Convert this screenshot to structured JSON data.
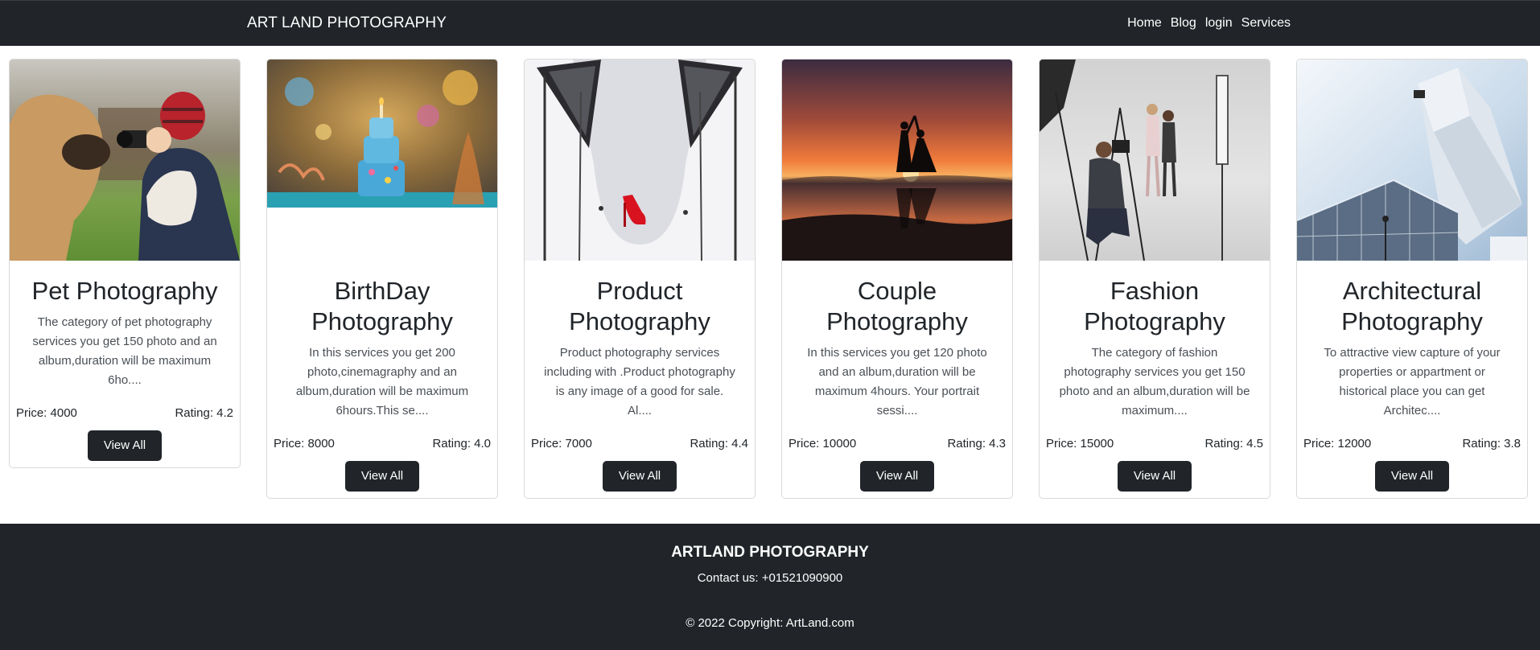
{
  "navbar": {
    "brand": "ART LAND PHOTOGRAPHY",
    "links": [
      "Home",
      "Blog",
      "login",
      "Services"
    ]
  },
  "cards": [
    {
      "image": "dog-and-child-photographer-photo",
      "title": "Pet Photography",
      "description": "The category of pet photography services you get 150 photo and an album,duration will be maximum 6ho....",
      "price": "Price: 4000",
      "rating": "Rating: 4.2",
      "button": "View All"
    },
    {
      "image": "birthday-cake-photo",
      "title": "BirthDay Photography",
      "description": "In this services you get 200 photo,cinemagraphy and an album,duration will be maximum 6hours.This se....",
      "price": "Price: 8000",
      "rating": "Rating: 4.0",
      "button": "View All"
    },
    {
      "image": "studio-red-heel-photo",
      "title": "Product Photography",
      "description": "Product photography services including with .Product photography is any image of a good for sale. Al....",
      "price": "Price: 7000",
      "rating": "Rating: 4.4",
      "button": "View All"
    },
    {
      "image": "couple-sunset-silhouette-photo",
      "title": "Couple Photography",
      "description": "In this services you get 120 photo and an album,duration will be maximum 4hours. Your portrait sessi....",
      "price": "Price: 10000",
      "rating": "Rating: 4.3",
      "button": "View All"
    },
    {
      "image": "fashion-studio-shoot-photo",
      "title": "Fashion Photography",
      "description": "The category of fashion photography services you get 150 photo and an album,duration will be maximum....",
      "price": "Price: 15000",
      "rating": "Rating: 4.5",
      "button": "View All"
    },
    {
      "image": "modern-building-photo",
      "title": "Architectural Photography",
      "description": "To attractive view capture of your properties or appartment or historical place you can get Architec....",
      "price": "Price: 12000",
      "rating": "Rating: 3.8",
      "button": "View All"
    }
  ],
  "footer": {
    "title": "ARTLAND PHOTOGRAPHY",
    "contact": "Contact us: +01521090900",
    "copyright": "© 2022 Copyright: ArtLand.com"
  }
}
